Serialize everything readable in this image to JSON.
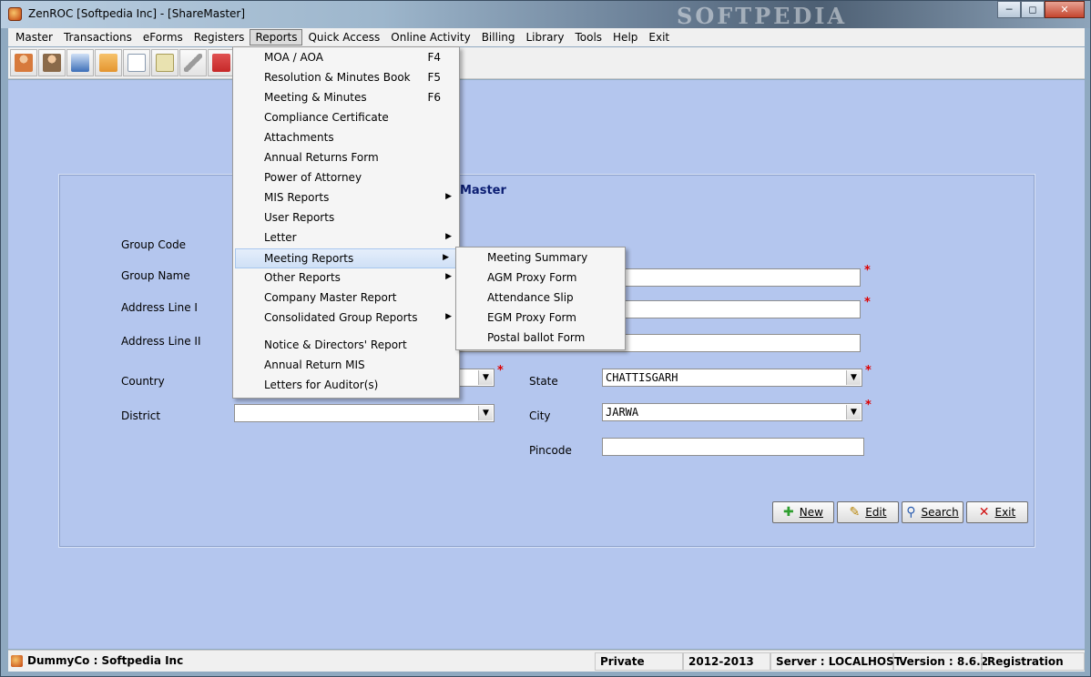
{
  "window": {
    "title": "ZenROC [Softpedia Inc] - [ShareMaster]",
    "watermark": "SOFTPEDIA",
    "controls": [
      "minimize",
      "maximize",
      "close"
    ]
  },
  "menubar": {
    "items": [
      {
        "label": "Master"
      },
      {
        "label": "Transactions"
      },
      {
        "label": "eForms"
      },
      {
        "label": "Registers"
      },
      {
        "label": "Reports"
      },
      {
        "label": "Quick Access"
      },
      {
        "label": "Online Activity"
      },
      {
        "label": "Billing"
      },
      {
        "label": "Library"
      },
      {
        "label": "Tools"
      },
      {
        "label": "Help"
      },
      {
        "label": "Exit"
      }
    ]
  },
  "toolbar": {
    "icons": [
      "user-edit-icon",
      "user-pen-icon",
      "ia-form-icon",
      "folder-box-icon",
      "document-icon",
      "scroll-icon",
      "paperclip-icon",
      "red-book-icon"
    ],
    "colors": [
      "#d77a3c",
      "#8a6a4a",
      "#3d6fb8",
      "#e4952f",
      "#ffffff",
      "#e9e2b0",
      "#9b9b9b",
      "#c62828"
    ]
  },
  "panel": {
    "title": "Master"
  },
  "form": {
    "group_code_label": "Group Code",
    "group_name_label": "Group Name",
    "address1_label": "Address Line I",
    "address2_label": "Address Line II",
    "country_label": "Country",
    "district_label": "District",
    "state_label": "State",
    "state_value": "CHATTISGARH",
    "city_label": "City",
    "city_value": "JARWA",
    "pincode_label": "Pincode",
    "district_value": "",
    "pincode_value": ""
  },
  "buttons": {
    "new": "New",
    "edit": "Edit",
    "search": "Search",
    "exit": "Exit"
  },
  "reports_menu": {
    "items": [
      {
        "label": "MOA / AOA",
        "shortcut": "F4"
      },
      {
        "label": "Resolution & Minutes Book",
        "shortcut": "F5"
      },
      {
        "label": "Meeting & Minutes",
        "shortcut": "F6"
      },
      {
        "label": "Compliance Certificate"
      },
      {
        "label": "Attachments"
      },
      {
        "label": "Annual Returns Form"
      },
      {
        "label": "Power of Attorney"
      },
      {
        "label": "MIS Reports",
        "submenu": true
      },
      {
        "label": "User Reports"
      },
      {
        "label": "Letter",
        "submenu": true
      },
      {
        "label": "Meeting Reports",
        "submenu": true,
        "highlighted": true
      },
      {
        "label": "Other Reports",
        "submenu": true
      },
      {
        "label": "Company Master Report"
      },
      {
        "label": "Consolidated Group Reports",
        "submenu": true
      },
      {
        "label": "Notice & Directors' Report"
      },
      {
        "label": "Annual Return MIS"
      },
      {
        "label": "Letters for Auditor(s)"
      }
    ]
  },
  "meeting_reports_submenu": {
    "items": [
      {
        "label": "Meeting Summary"
      },
      {
        "label": "AGM Proxy Form"
      },
      {
        "label": "Attendance Slip"
      },
      {
        "label": "EGM Proxy Form"
      },
      {
        "label": "Postal ballot Form"
      }
    ]
  },
  "statusbar": {
    "company": "DummyCo : Softpedia Inc",
    "mode": "Private",
    "year": "2012-2013",
    "server": "Server : LOCALHOST",
    "version": "Version : 8.6.2",
    "registration": "Registration"
  }
}
